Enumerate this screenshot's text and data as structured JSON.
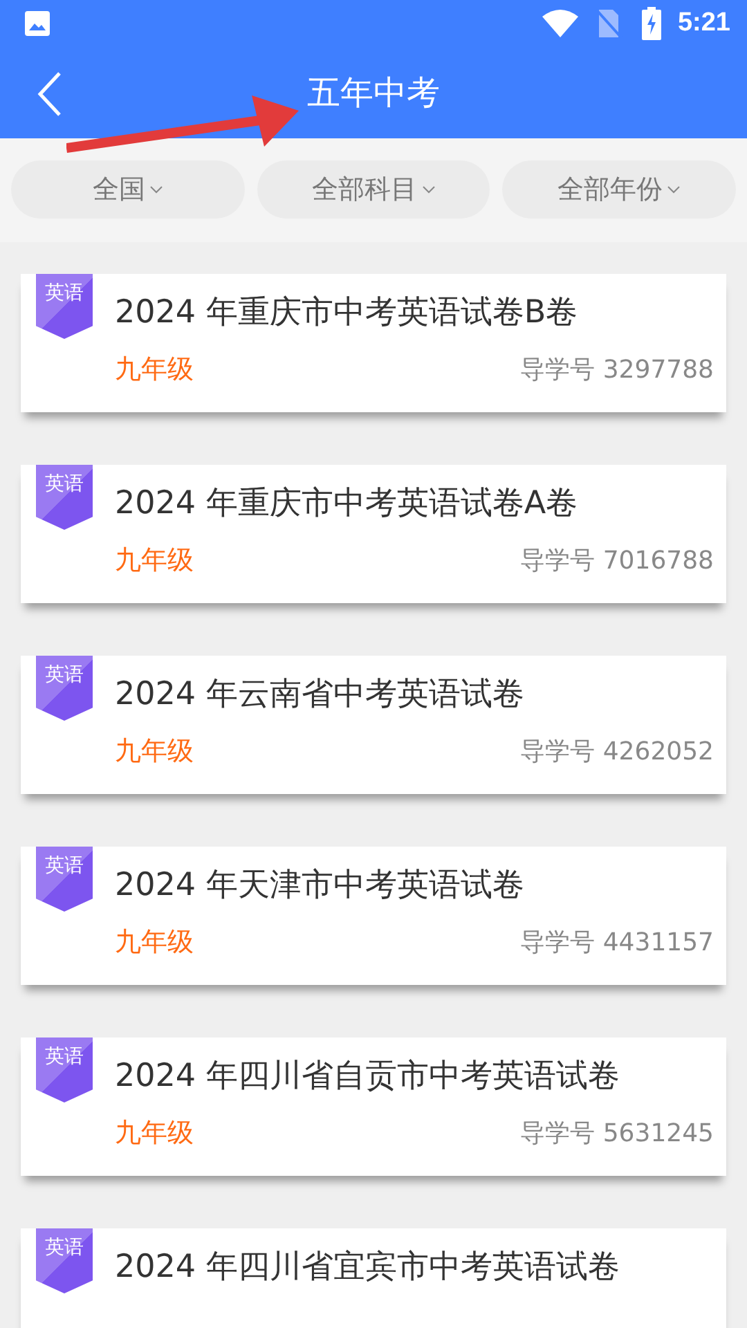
{
  "status_bar": {
    "time": "5:21"
  },
  "app_bar": {
    "title": "五年中考"
  },
  "filters": [
    {
      "label": "全国"
    },
    {
      "label": "全部科目"
    },
    {
      "label": "全部年份"
    }
  ],
  "papers": [
    {
      "subject": "英语",
      "title": "2024 年重庆市中考英语试卷B卷",
      "grade": "九年级",
      "code": "导学号 3297788"
    },
    {
      "subject": "英语",
      "title": "2024 年重庆市中考英语试卷A卷",
      "grade": "九年级",
      "code": "导学号 7016788"
    },
    {
      "subject": "英语",
      "title": "2024 年云南省中考英语试卷",
      "grade": "九年级",
      "code": "导学号 4262052"
    },
    {
      "subject": "英语",
      "title": "2024 年天津市中考英语试卷",
      "grade": "九年级",
      "code": "导学号 4431157"
    },
    {
      "subject": "英语",
      "title": "2024 年四川省自贡市中考英语试卷",
      "grade": "九年级",
      "code": "导学号 5631245"
    },
    {
      "subject": "英语",
      "title": "2024 年四川省宜宾市中考英语试卷"
    }
  ]
}
